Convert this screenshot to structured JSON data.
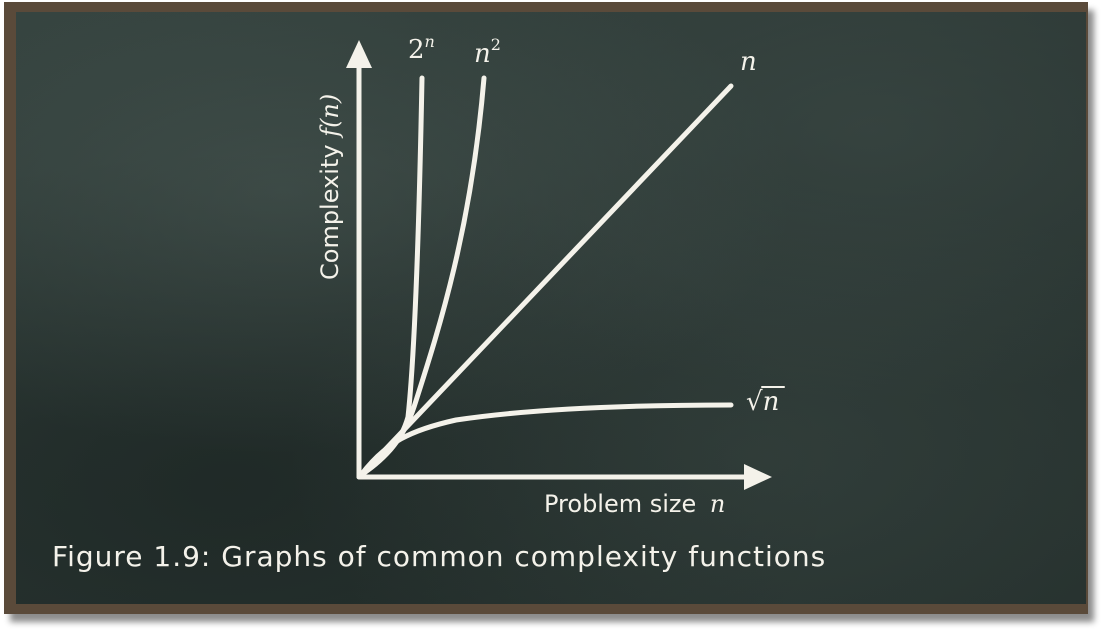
{
  "figure": {
    "caption": "Figure 1.9: Graphs of common complexity functions",
    "y_axis_label_prefix": "Complexity ",
    "y_axis_label_func": "f(n)",
    "x_axis_label_prefix": "Problem size ",
    "x_axis_label_var": "n",
    "curves": [
      {
        "id": "exponential",
        "label_base": "2",
        "label_sup": "n"
      },
      {
        "id": "quadratic",
        "label_base": "n",
        "label_sup": "2"
      },
      {
        "id": "linear",
        "label_base": "n"
      },
      {
        "id": "sqrt",
        "label_symbol": "√",
        "label_base": "n"
      }
    ]
  },
  "colors": {
    "chalk": "#f4f2ea",
    "board": "#2c3835",
    "frame": "#5a4a3a"
  }
}
